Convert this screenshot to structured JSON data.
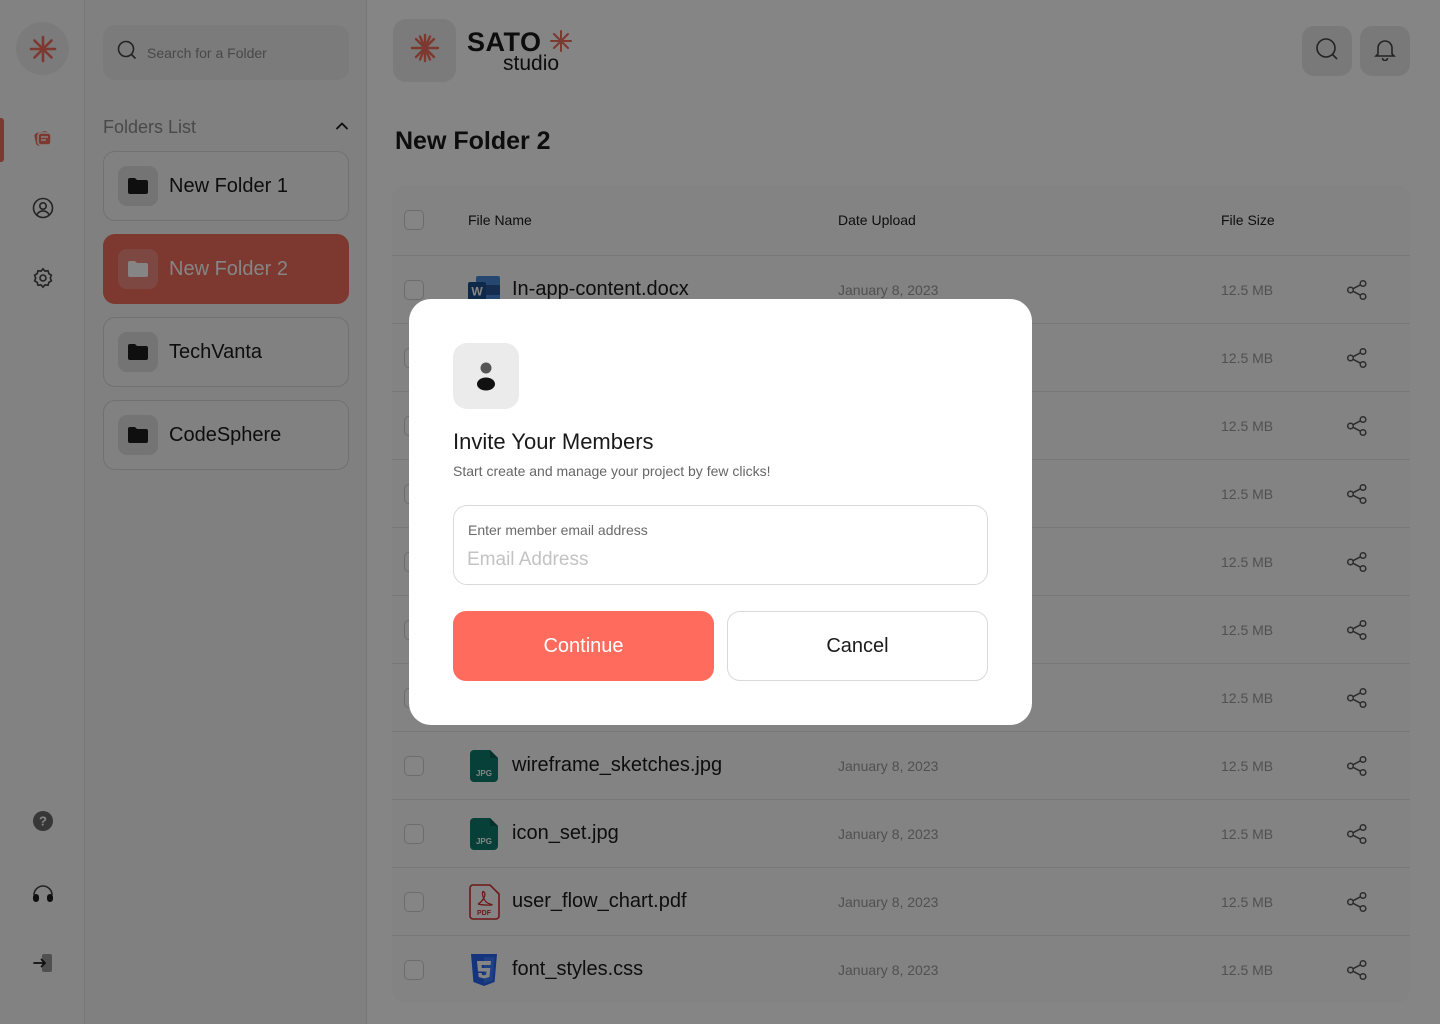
{
  "colors": {
    "accent": "#ef6b5c",
    "continue_button": "#ff6b5d",
    "word": "#2b579a",
    "jpg": "#0e7c6b",
    "pdf": "#d32f2f",
    "css": "#2965f1"
  },
  "brand": {
    "name": "SATO",
    "sub": "studio"
  },
  "rail": {
    "logo_icon": "asterisk-logo-icon",
    "items": [
      {
        "icon": "folders-icon",
        "active": true
      },
      {
        "icon": "user-circle-icon"
      },
      {
        "icon": "gear-icon"
      },
      {
        "icon": "help-icon"
      },
      {
        "icon": "headset-icon"
      },
      {
        "icon": "logout-icon"
      }
    ]
  },
  "sidebar": {
    "search_placeholder": "Search for a Folder",
    "folders_title": "Folders List",
    "folders": [
      {
        "label": "New Folder 1"
      },
      {
        "label": "New Folder 2",
        "active": true
      },
      {
        "label": "TechVanta"
      },
      {
        "label": "CodeSphere"
      }
    ]
  },
  "main": {
    "title": "New Folder 2",
    "columns": {
      "name": "File Name",
      "date": "Date Upload",
      "size": "File Size"
    },
    "files": [
      {
        "name": "In-app-content.docx",
        "type": "word",
        "date": "January 8, 2023",
        "size": "12.5 MB"
      },
      {
        "name": "",
        "type": "",
        "date": "",
        "size": "12.5 MB"
      },
      {
        "name": "",
        "type": "",
        "date": "",
        "size": "12.5 MB"
      },
      {
        "name": "",
        "type": "",
        "date": "",
        "size": "12.5 MB"
      },
      {
        "name": "",
        "type": "",
        "date": "",
        "size": "12.5 MB"
      },
      {
        "name": "",
        "type": "",
        "date": "",
        "size": "12.5 MB"
      },
      {
        "name": "",
        "type": "",
        "date": "",
        "size": "12.5 MB"
      },
      {
        "name": "wireframe_sketches.jpg",
        "type": "jpg",
        "date": "January 8, 2023",
        "size": "12.5 MB"
      },
      {
        "name": "icon_set.jpg",
        "type": "jpg",
        "date": "January 8, 2023",
        "size": "12.5 MB"
      },
      {
        "name": "user_flow_chart.pdf",
        "type": "pdf",
        "date": "January 8, 2023",
        "size": "12.5 MB"
      },
      {
        "name": "font_styles.css",
        "type": "css",
        "date": "January 8, 2023",
        "size": "12.5 MB"
      }
    ]
  },
  "modal": {
    "icon": "user-icon",
    "title": "Invite Your Members",
    "subtitle": "Start create and manage your project by few clicks!",
    "field_label": "Enter member email address",
    "field_placeholder": "Email Address",
    "field_value": "",
    "continue_label": "Continue",
    "cancel_label": "Cancel"
  }
}
